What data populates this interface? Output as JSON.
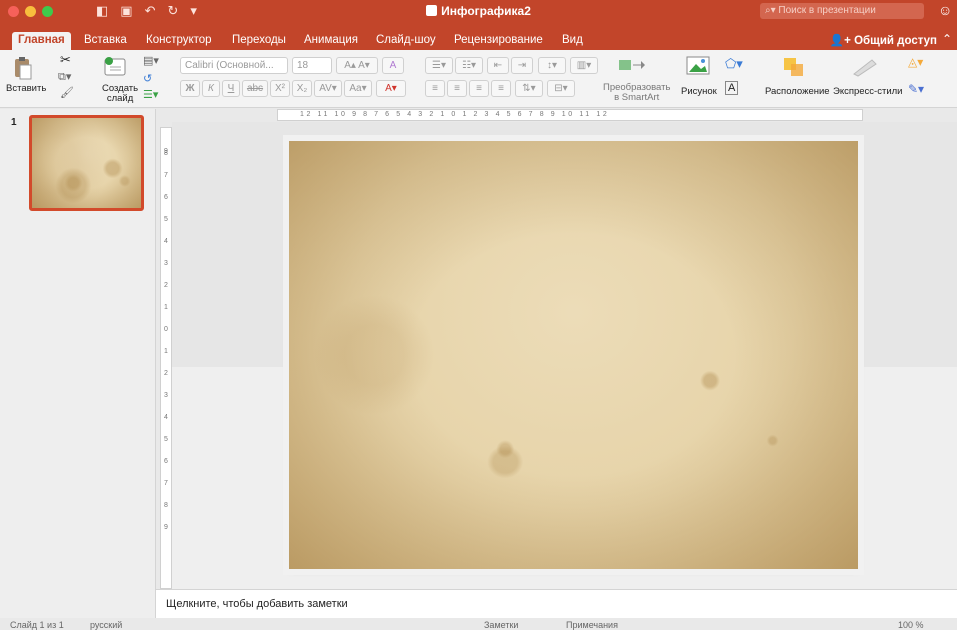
{
  "app": {
    "doc_title": "Инфографика2",
    "search_placeholder": "Поиск в презентации"
  },
  "ribbon_tabs": [
    "Главная",
    "Вставка",
    "Конструктор",
    "Переходы",
    "Анимация",
    "Слайд-шоу",
    "Рецензирование",
    "Вид"
  ],
  "active_tab": "Главная",
  "share_label": "Общий доступ",
  "toolbar": {
    "paste_label": "Вставить",
    "new_slide_line1": "Создать",
    "new_slide_line2": "слайд",
    "font_name": "Calibri (Основной...",
    "font_size": "18",
    "bold": "Ж",
    "italic": "К",
    "underline": "Ч",
    "strike": "abc",
    "superscript": "X²",
    "subscript": "X₂",
    "smartart_line1": "Преобразовать",
    "smartart_line2": "в SmartArt",
    "picture_label": "Рисунок",
    "arrange_label": "Расположение",
    "quick_styles_label": "Экспресс-стили"
  },
  "thumbnails": [
    {
      "number": "1"
    }
  ],
  "ruler_labels": "12 11 10 9 8 7 6 5 4 3 2 1 0 1 2 3 4 5 6 7 8 9 10 11 12",
  "vruler_labels": [
    "9",
    "8",
    "7",
    "6",
    "5",
    "4",
    "3",
    "2",
    "1",
    "0",
    "1",
    "2",
    "3",
    "4",
    "5",
    "6",
    "7",
    "8",
    "9"
  ],
  "notes_placeholder": "Щелкните, чтобы добавить заметки",
  "status": {
    "slide_info": "Слайд 1 из 1",
    "language": "русский",
    "notes_btn": "Заметки",
    "comments_btn": "Примечания",
    "zoom": "100 %"
  },
  "colors": {
    "accent": "#c2452a",
    "selected_thumb": "#d24a2b"
  }
}
